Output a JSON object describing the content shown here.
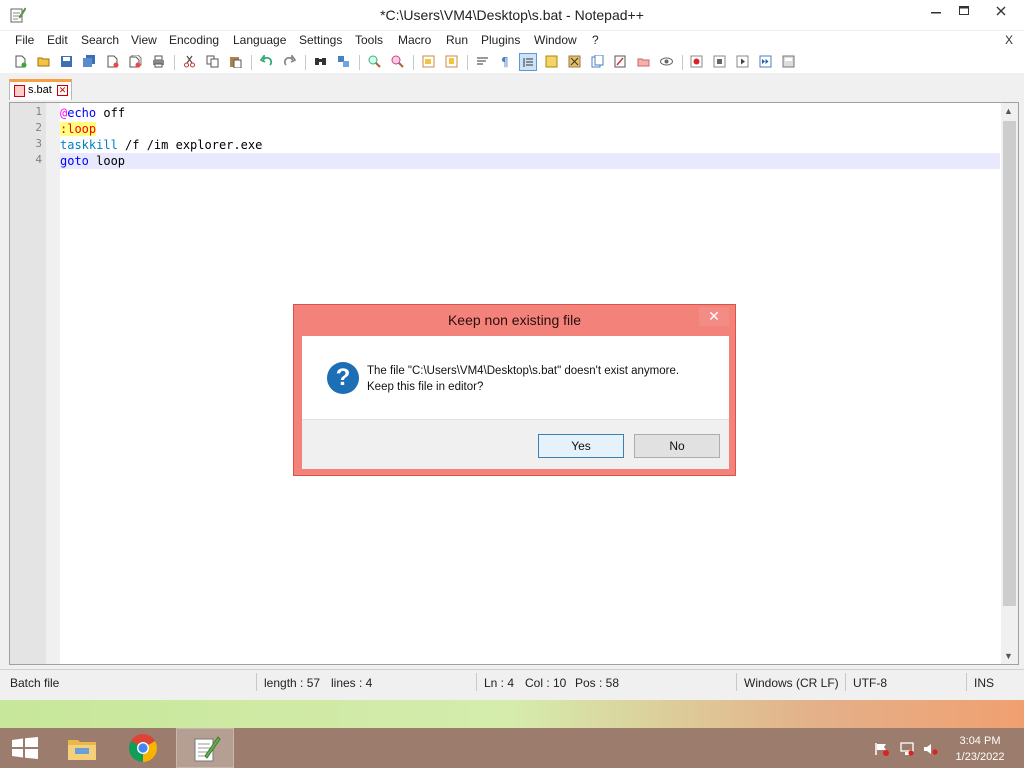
{
  "window": {
    "title": "*C:\\Users\\VM4\\Desktop\\s.bat - Notepad++"
  },
  "menu": {
    "items": [
      "File",
      "Edit",
      "Search",
      "View",
      "Encoding",
      "Language",
      "Settings",
      "Tools",
      "Macro",
      "Run",
      "Plugins",
      "Window",
      "?"
    ],
    "close": "X"
  },
  "toolbar": {
    "icons": [
      "new-file-icon",
      "open-file-icon",
      "save-icon",
      "save-all-icon",
      "close-icon",
      "close-all-icon",
      "print-icon",
      "cut-icon",
      "copy-icon",
      "paste-icon",
      "undo-icon",
      "redo-icon",
      "find-icon",
      "replace-icon",
      "zoom-in-icon",
      "zoom-out-icon",
      "sync-vertical-icon",
      "sync-horizontal-icon",
      "word-wrap-icon",
      "show-all-characters-icon",
      "indent-guide-icon",
      "user-defined-language-icon",
      "document-map-icon",
      "function-list-icon",
      "folder-as-workspace-icon",
      "monitoring-icon",
      "record-macro-icon",
      "stop-macro-icon",
      "play-macro-icon",
      "run-macro-multiple-icon",
      "save-macro-icon"
    ]
  },
  "tab": {
    "label": "s.bat",
    "close": "✕"
  },
  "editor": {
    "lines": [
      {
        "num": "1",
        "tokens": [
          {
            "t": "@",
            "c": "#ff00ff"
          },
          {
            "t": "echo",
            "c": "#0000ff"
          },
          {
            "t": " off",
            "c": "#000000"
          }
        ]
      },
      {
        "num": "2",
        "tokens": [
          {
            "t": ":loop",
            "c": "#ff0000",
            "hl": true
          }
        ]
      },
      {
        "num": "3",
        "tokens": [
          {
            "t": "taskkill",
            "c": "#0080c0"
          },
          {
            "t": " /f /im explorer.exe",
            "c": "#000000"
          }
        ]
      },
      {
        "num": "4",
        "tokens": [
          {
            "t": "goto",
            "c": "#0000ff"
          },
          {
            "t": " loop",
            "c": "#000000"
          }
        ]
      }
    ]
  },
  "status": {
    "lang": "Batch file",
    "length": "length : 57",
    "lines": "lines : 4",
    "ln": "Ln : 4",
    "col": "Col : 10",
    "pos": "Pos : 58",
    "eol": "Windows (CR LF)",
    "encoding": "UTF-8",
    "mode": "INS"
  },
  "dialog": {
    "title": "Keep non existing file",
    "close": "✕",
    "message_line1": "The file \"C:\\Users\\VM4\\Desktop\\s.bat\" doesn't exist anymore.",
    "message_line2": "Keep this file in editor?",
    "yes": "Yes",
    "no": "No",
    "icon": "?"
  },
  "taskbar": {
    "time": "3:04 PM",
    "date": "1/23/2022"
  }
}
